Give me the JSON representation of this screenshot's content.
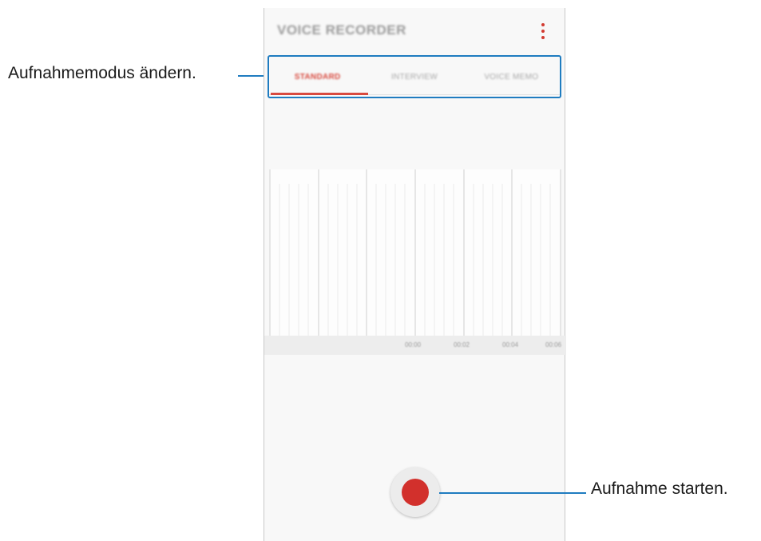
{
  "app": {
    "title": "VOICE RECORDER",
    "tabs": [
      "STANDARD",
      "INTERVIEW",
      "VOICE MEMO"
    ],
    "active_tab": "STANDARD",
    "timeline_labels": [
      "00:00",
      "00:02",
      "00:04",
      "00:06"
    ],
    "accent_color": "#d84a3f",
    "record_color": "#d2302c"
  },
  "callouts": {
    "mode": "Aufnahmemodus ändern.",
    "record": "Aufnahme starten."
  },
  "icons": {
    "menu": "more-vertical-icon",
    "record": "record-dot-icon"
  }
}
